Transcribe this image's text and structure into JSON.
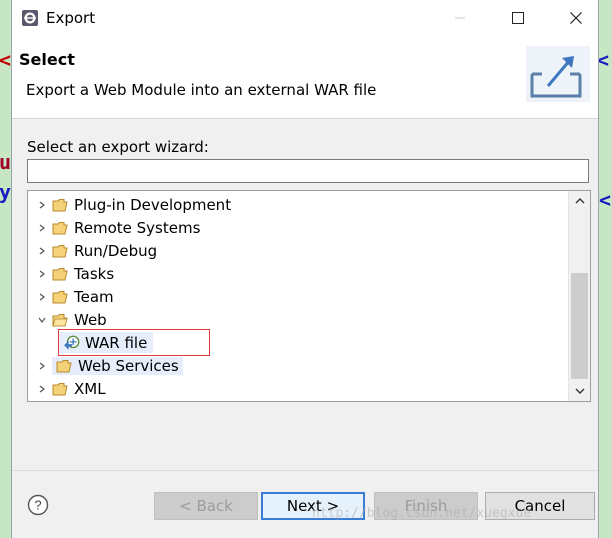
{
  "window": {
    "title": "Export"
  },
  "banner": {
    "title": "Select",
    "description": "Export a Web Module into an external WAR file"
  },
  "wizard": {
    "label": "Select an export wizard:",
    "filter_value": "",
    "filter_placeholder": ""
  },
  "tree": {
    "items": [
      {
        "label": "Plug-in Development",
        "state": "collapsed"
      },
      {
        "label": "Remote Systems",
        "state": "collapsed"
      },
      {
        "label": "Run/Debug",
        "state": "collapsed"
      },
      {
        "label": "Tasks",
        "state": "collapsed"
      },
      {
        "label": "Team",
        "state": "collapsed"
      },
      {
        "label": "Web",
        "state": "expanded"
      },
      {
        "label": "WAR file",
        "state": "selected"
      },
      {
        "label": "Web Services",
        "state": "collapsed"
      },
      {
        "label": "XML",
        "state": "collapsed"
      }
    ]
  },
  "buttons": {
    "back": "< Back",
    "next": "Next >",
    "finish": "Finish",
    "cancel": "Cancel"
  },
  "watermark": "http://blog.csdn.net/xuegxue",
  "colors": {
    "background": "#c7e6c4",
    "highlight_box": "#e03a3a",
    "default_button": "#3a7bd5",
    "selection": "#e6eefb"
  }
}
